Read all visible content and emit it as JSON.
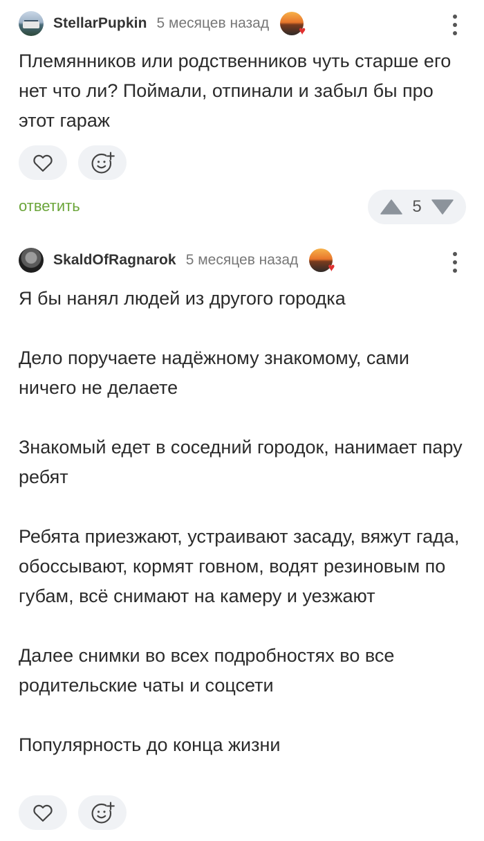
{
  "comments": [
    {
      "username": "StellarPupkin",
      "time": "5 месяцев назад",
      "paragraphs": [
        "Племянников или родственников чуть старше его нет что ли? Поймали, отпинали и забыл бы про этот гараж"
      ],
      "reply_label": "ответить",
      "rating": "5"
    },
    {
      "username": "SkaldOfRagnarok",
      "time": "5 месяцев назад",
      "paragraphs": [
        "Я бы нанял людей из другого городка",
        "Дело поручаете надёжному знакомому, сами ничего не делаете",
        "Знакомый едет в соседний городок, нанимает пару ребят",
        "Ребята приезжают, устраивают засаду, вяжут гада, обоссывают, кормят говном, водят резиновым по губам, всё снимают на камеру и уезжают",
        "Далее снимки во всех подробностях во все родительские чаты и соцсети",
        "Популярность до конца жизни"
      ]
    }
  ],
  "icons": {
    "like": "heart-outline-icon",
    "reaction": "add-reaction-icon",
    "more": "more-vertical-icon",
    "upvote": "triangle-up-icon",
    "downvote": "triangle-down-icon"
  },
  "colors": {
    "reply": "#6ba53a",
    "pill_bg": "#f0f2f5"
  }
}
